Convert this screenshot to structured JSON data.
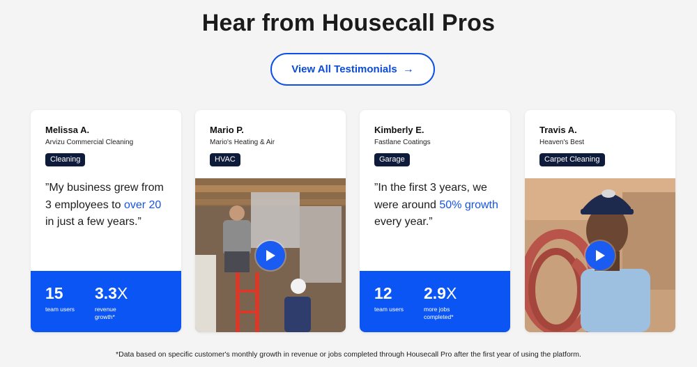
{
  "heading": "Hear from Housecall Pros",
  "cta": {
    "label": "View All Testimonials",
    "arrow": "→"
  },
  "cards": [
    {
      "name": "Melissa A.",
      "company": "Arvizu Commercial Cleaning",
      "tag": "Cleaning",
      "quote": {
        "open": "”My business grew from 3 employees to ",
        "highlight": "over 20",
        "close": " in just a few years.”"
      },
      "stats": [
        {
          "value": "15",
          "suffix": "",
          "label": "team users"
        },
        {
          "value": "3.3",
          "suffix": "X",
          "label": "revenue growth*"
        }
      ]
    },
    {
      "name": "Mario P.",
      "company": "Mario's Heating & Air",
      "tag": "HVAC",
      "video_icon": "play-icon"
    },
    {
      "name": "Kimberly E.",
      "company": "Fastlane Coatings",
      "tag": "Garage",
      "quote": {
        "open": "”In the first 3 years, we were around ",
        "highlight": "50% growth",
        "close": " every year.”"
      },
      "stats": [
        {
          "value": "12",
          "suffix": "",
          "label": "team users"
        },
        {
          "value": "2.9",
          "suffix": "X",
          "label": "more jobs completed*"
        }
      ]
    },
    {
      "name": "Travis A.",
      "company": "Heaven's Best",
      "tag": "Carpet Cleaning",
      "video_icon": "play-icon"
    }
  ],
  "footnote": "*Data based on specific customer's monthly growth in revenue or jobs completed through Housecall Pro after the first year of using the platform.",
  "colors": {
    "accent": "#0b55f5",
    "tag_bg": "#0e1b3a",
    "highlight": "#1653e6"
  }
}
